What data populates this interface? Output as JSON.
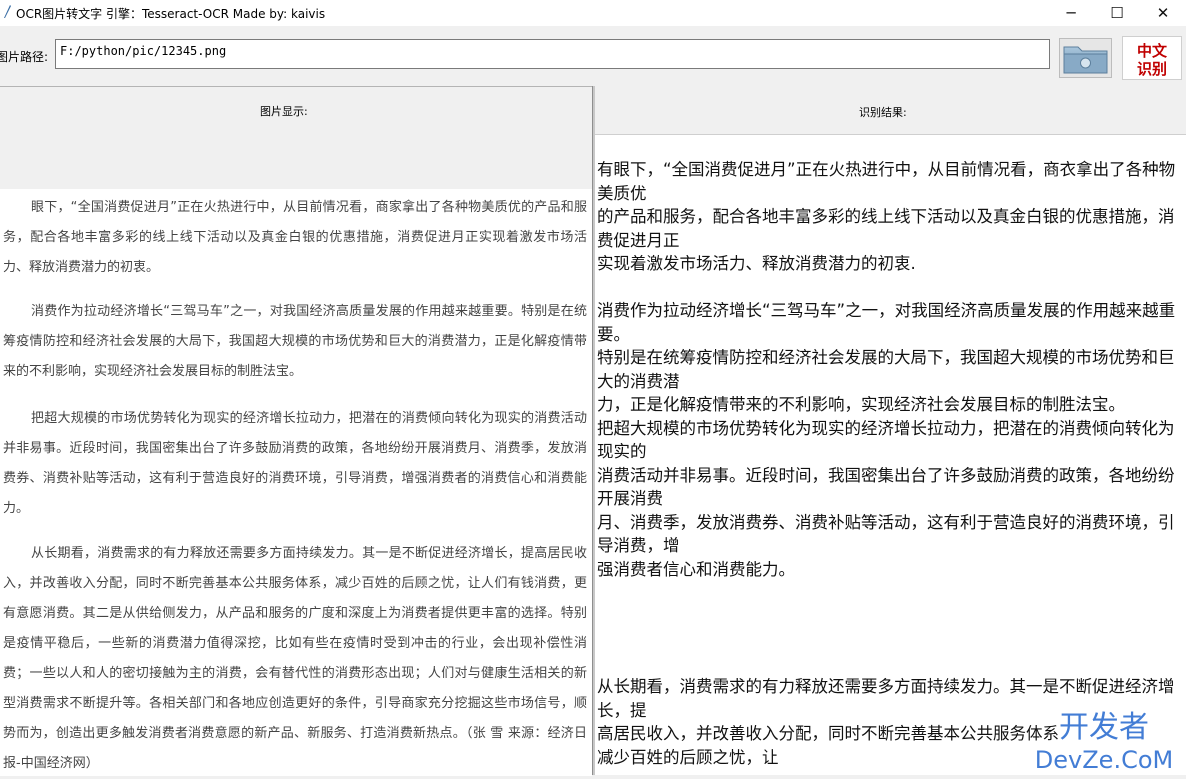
{
  "window": {
    "title": "OCR图片转文字  引擎：Tesseract-OCR  Made by: kaivis",
    "minimize": "─",
    "maximize": "☐",
    "close": "✕"
  },
  "path_bar": {
    "label": "图片路径:",
    "value": "F:/python/pic/12345.png",
    "folder_icon": "folder-icon",
    "ocr_button_line1": "中文",
    "ocr_button_line2": "识别"
  },
  "left_panel": {
    "header": "图片显示:",
    "image_paragraphs": [
      "眼下，“全国消费促进月”正在火热进行中，从目前情况看，商家拿出了各种物美质优的产品和服务，配合各地丰富多彩的线上线下活动以及真金白银的优惠措施，消费促进月正实现着激发市场活力、释放消费潜力的初衷。",
      "消费作为拉动经济增长“三驾马车”之一，对我国经济高质量发展的作用越来越重要。特别是在统筹疫情防控和经济社会发展的大局下，我国超大规模的市场优势和巨大的消费潜力，正是化解疫情带来的不利影响，实现经济社会发展目标的制胜法宝。",
      "把超大规模的市场优势转化为现实的经济增长拉动力，把潜在的消费倾向转化为现实的消费活动并非易事。近段时间，我国密集出台了许多鼓励消费的政策，各地纷纷开展消费月、消费季，发放消费券、消费补贴等活动，这有利于营造良好的消费环境，引导消费，增强消费者的消费信心和消费能力。",
      "从长期看，消费需求的有力释放还需要多方面持续发力。其一是不断促进经济增长，提高居民收入，并改善收入分配，同时不断完善基本公共服务体系，减少百姓的后顾之忧，让人们有钱消费，更有意愿消费。其二是从供给侧发力，从产品和服务的广度和深度上为消费者提供更丰富的选择。特别是疫情平稳后，一些新的消费潜力值得深挖，比如有些在疫情时受到冲击的行业，会出现补偿性消费；一些以人和人的密切接触为主的消费，会有替代性的消费形态出现；人们对与健康生活相关的新型消费需求不断提升等。各相关部门和各地应创造更好的条件，引导商家充分挖掘这些市场信号，顺势而为，创造出更多触发消费者消费意愿的新产品、新服务、打造消费新热点。（张 雪 来源：经济日报-中国经济网）"
    ]
  },
  "right_panel": {
    "header": "识别结果:",
    "result_text": "有眼下，“全国消费促进月”正在火热进行中，从目前情况看，商衣拿出了各种物美质优\n的产品和服务，配合各地丰富多彩的线上线下活动以及真金白银的优惠措施，消费促进月正\n实现着激发市场活力、释放消费潜力的初衷.\n\n消费作为拉动经济增长“三驾马车”之一，对我国经济高质量发展的作用越来越重要。\n特别是在统筹疫情防控和经济社会发展的大局下，我国超大规模的市场优势和巨大的消费潜\n力，正是化解疫情带来的不利影响，实现经济社会发展目标的制胜法宝。\n把超大规模的市场优势转化为现实的经济增长拉动力，把潜在的消费倾向转化为现实的\n消费活动并非易事。近段时间，我国密集出台了许多鼓励消费的政策，各地纷纷开展消费\n月、消费季，发放消费券、消费补贴等活动，这有利于营造良好的消费环境，引导消费，增\n强消费者信心和消费能力。\n\n\n\n\n从长期看，消费需求的有力释放还需要多方面持续发力。其一是不断促进经济增长，提\n高居民收入，并改善收入分配，同时不断完善基本公共服务体系\n减少百姓的后顾之忧，让"
  },
  "watermark": {
    "line1": "开发者",
    "line2": "DevZe.CoM"
  }
}
